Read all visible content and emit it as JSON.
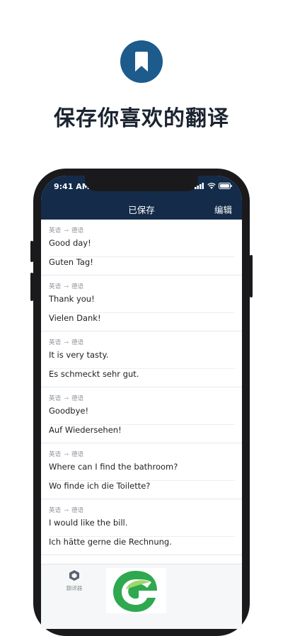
{
  "headline": "保存你喜欢的翻译",
  "status": {
    "time": "9:41 AM"
  },
  "nav": {
    "title": "已保存",
    "edit": "编辑"
  },
  "items": [
    {
      "from": "英语",
      "to": "德语",
      "source": "Good day!",
      "target": "Guten Tag!"
    },
    {
      "from": "英语",
      "to": "德语",
      "source": "Thank you!",
      "target": "Vielen Dank!"
    },
    {
      "from": "英语",
      "to": "德语",
      "source": "It is very tasty.",
      "target": "Es schmeckt sehr gut."
    },
    {
      "from": "英语",
      "to": "德语",
      "source": "Goodbye!",
      "target": "Auf Wiedersehen!"
    },
    {
      "from": "英语",
      "to": "德语",
      "source": "Where can I find the bathroom?",
      "target": "Wo finde ich die Toilette?"
    },
    {
      "from": "英语",
      "to": "德语",
      "source": "I would like the bill.",
      "target": "Ich hätte gerne die Rechnung."
    }
  ],
  "tabbar": {
    "translator_label": "翻译器",
    "translator_icon": "cube-icon"
  },
  "colors": {
    "badge": "#1d5b8c",
    "navbar": "#142b4a",
    "logo_green": "#2fa84f"
  }
}
